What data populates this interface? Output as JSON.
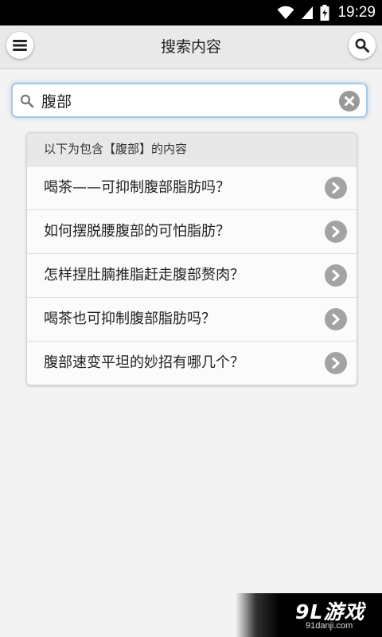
{
  "status_bar": {
    "time": "19:29",
    "icons": [
      "wifi-icon",
      "signal-icon",
      "battery-charging-icon"
    ]
  },
  "header": {
    "title": "搜索内容",
    "menu_icon": "hamburger-menu-icon",
    "search_icon": "search-icon"
  },
  "search": {
    "value": "腹部",
    "icon": "search-icon",
    "clear_icon": "clear-icon"
  },
  "results": {
    "heading": "以下为包含【腹部】的内容",
    "items": [
      {
        "title": "喝茶——可抑制腹部脂肪吗？"
      },
      {
        "title": "如何摆脱腰腹部的可怕脂肪？"
      },
      {
        "title": "怎样捏肚腩推脂赶走腹部赘肉？"
      },
      {
        "title": "喝茶也可抑制腹部脂肪吗？"
      },
      {
        "title": "腹部速变平坦的妙招有哪几个？"
      }
    ],
    "item_icon": "chevron-right-icon"
  },
  "watermark": {
    "brand": "9L游戏",
    "url": "91danji.com"
  },
  "colors": {
    "status_bar": "#000000",
    "header": "#e9e9e9",
    "search_focus": "#a9c9e8",
    "arrow": "#a3a3a3"
  }
}
